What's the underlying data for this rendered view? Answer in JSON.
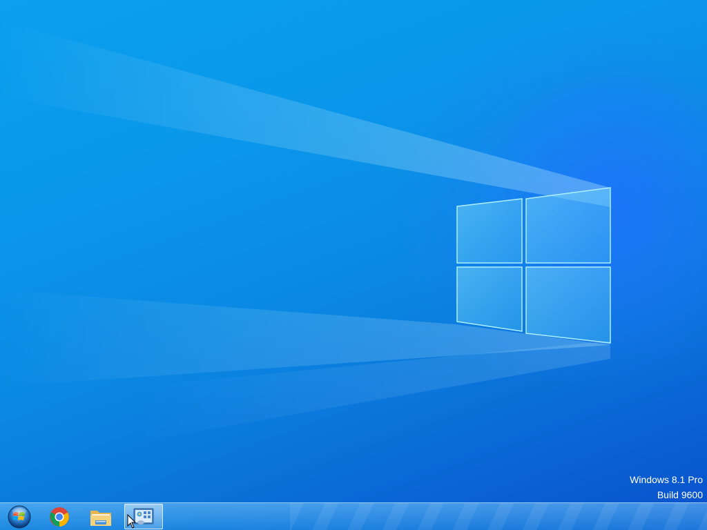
{
  "desktop": {
    "wallpaper": "windows-logo-light-beams",
    "colors": {
      "wallpaper_light": "#0aa0ee",
      "wallpaper_dark": "#0a4fcb",
      "logo_pane": "#5ec8f7",
      "logo_edge": "#9fe6ff"
    }
  },
  "watermark": {
    "line1": "Windows 8.1 Pro",
    "line2": "Build 9600"
  },
  "taskbar": {
    "items": [
      {
        "name": "start-button",
        "icon": "windows-orb-icon"
      },
      {
        "name": "chrome",
        "icon": "chrome-icon"
      },
      {
        "name": "file-explorer",
        "icon": "folder-icon"
      },
      {
        "name": "control-panel",
        "icon": "control-panel-icon",
        "active": true
      }
    ]
  }
}
